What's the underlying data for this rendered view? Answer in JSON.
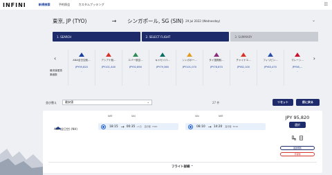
{
  "app": {
    "logo": "INFINI",
    "nav": [
      "新規検索",
      "予約照会",
      "カスタムブッキング"
    ],
    "user_icon": "user-menu-icon"
  },
  "route": {
    "from": "東京, JP (TYO)",
    "to": "シンガポール, SG (SIN)",
    "date": "29 Jul 2022 (Wednesday)"
  },
  "steps": [
    "1. SEARCH",
    "2. SELECT FLIGHT",
    "3. SUMMARY"
  ],
  "matrix": {
    "row_labels": [
      "最安値運賃",
      "乗継数"
    ],
    "airlines": [
      {
        "name": "ANA全日空航...",
        "price": "JPY95,820",
        "extra": "-",
        "color": "#1a3fa0",
        "icon": "ana-logo-icon"
      },
      {
        "name": "アシアナ航...",
        "price": "JPY101,440",
        "extra": "-",
        "color": "#d6332b",
        "icon": "asiana-logo-icon"
      },
      {
        "name": "エバー航空...",
        "price": "JPY92,890",
        "extra": "-",
        "color": "#2e8b57",
        "icon": "eva-logo-icon"
      },
      {
        "name": "キャセイパ...",
        "price": "JPY79,360",
        "extra": "-",
        "color": "#0a6e64",
        "icon": "cathay-logo-icon"
      },
      {
        "name": "シンガポー...",
        "price": "JPY101,070",
        "extra": "-",
        "color": "#e29b1b",
        "icon": "singapore-logo-icon"
      },
      {
        "name": "タイ国際航...",
        "price": "JPY78,870",
        "extra": "-",
        "color": "#8b2c7a",
        "icon": "thai-logo-icon"
      },
      {
        "name": "チャイナエ...",
        "price": "JPY82,100",
        "extra": "-",
        "color": "#d6332b",
        "icon": "china-airlines-logo-icon"
      },
      {
        "name": "フィリピン...",
        "price": "JPY63,470",
        "extra": "-",
        "color": "#2b4fa6",
        "icon": "philippine-logo-icon"
      },
      {
        "name": "マレーシ...",
        "price": "JPY58,...",
        "extra": "-",
        "color": "#c8102e",
        "icon": "malaysia-logo-icon"
      }
    ]
  },
  "filter": {
    "label": "並び替え",
    "selected": "最安値",
    "count": "27 件",
    "reset": "リセット",
    "back": "前に戻る"
  },
  "result": {
    "airline": "ANA(全日空) (NH)",
    "outbound": {
      "from": "NRT",
      "to": "SIN",
      "dep": "18:15",
      "arr": "00:35",
      "plus": "+1日",
      "stops": "直行便",
      "dur": "7h20"
    },
    "inbound": {
      "from": "SIN",
      "to": "NRT",
      "dep": "08:10",
      "arr": "14:20",
      "stops": "直行便",
      "dur": "7h10"
    },
    "price": "JPY 95,820",
    "select": "選択",
    "rules": "運賃規則",
    "baggage": "手荷物",
    "details": "フライト詳細"
  }
}
